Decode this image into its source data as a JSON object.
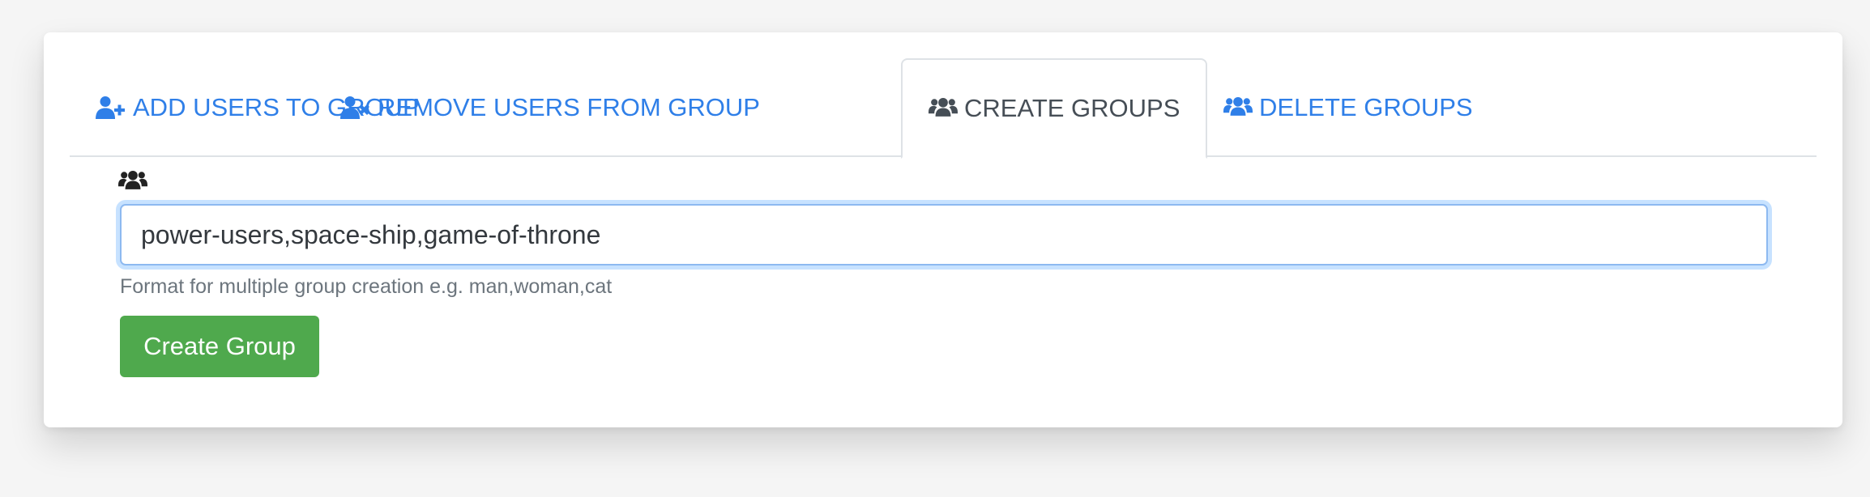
{
  "colors": {
    "link": "#2f7fe8",
    "active_tab_text": "#464e56",
    "button_green": "#4fa94d",
    "help_text": "#6c757d",
    "focus_border": "#8db9f0"
  },
  "tabs": [
    {
      "label": "ADD USERS TO GROUP",
      "icon": "user-plus-icon",
      "active": false
    },
    {
      "label": "REMOVE USERS FROM GROUP",
      "icon": "user-times-icon",
      "active": false
    },
    {
      "label": "CREATE GROUPS",
      "icon": "users-icon",
      "active": true
    },
    {
      "label": "DELETE GROUPS",
      "icon": "users-icon",
      "active": false
    }
  ],
  "form": {
    "field_icon": "users-icon",
    "group_input_value": "power-users,space-ship,game-of-throne",
    "help_text": "Format for multiple group creation e.g. man,woman,cat",
    "submit_label": "Create Group"
  }
}
